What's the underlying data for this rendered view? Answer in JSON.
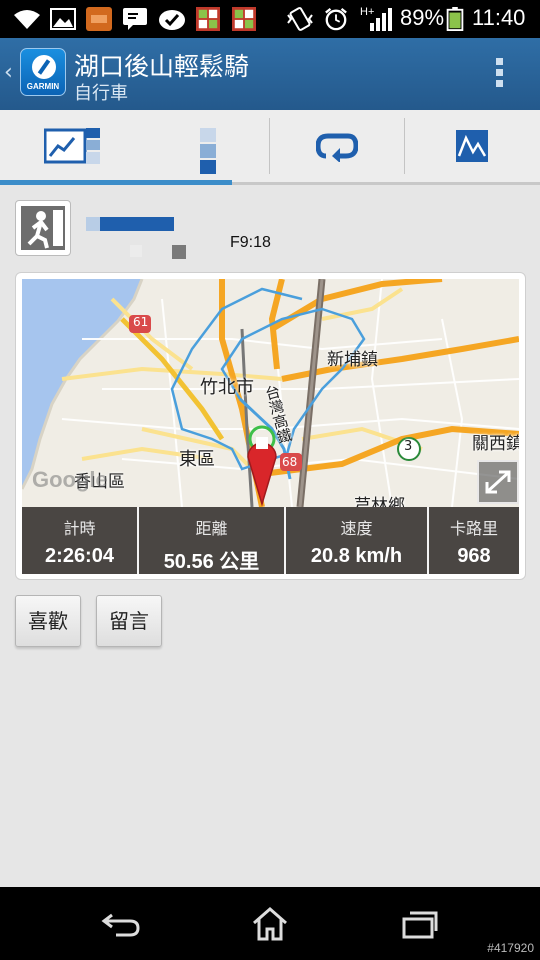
{
  "status_bar": {
    "icons": [
      "wifi-icon",
      "image-icon",
      "app-icon",
      "chat-icon",
      "check-icon",
      "grid-icon",
      "grid-icon",
      "vibrate-icon",
      "alarm-icon",
      "signal-icon",
      "battery-icon"
    ],
    "signal_label": "H+",
    "battery": "89%",
    "time": "11:40"
  },
  "action_bar": {
    "logo_text": "GARMIN",
    "title": "湖口後山輕鬆騎",
    "subtitle": "自行車"
  },
  "activity": {
    "time_text": "F9:18"
  },
  "map": {
    "labels": {
      "road_61": "61",
      "xinpu": "新埔鎮",
      "zhubei": "竹北市",
      "east_district": "東區",
      "xiangshan": "香山區",
      "guanxi": "關西鎮",
      "qionglin": "芎林鄉",
      "road_3": "3",
      "road_68": "68",
      "freeway": "台灣高鐵"
    },
    "google_text": "Google"
  },
  "stats": [
    {
      "label": "計時",
      "value": "2:26:04"
    },
    {
      "label": "距離",
      "value": "50.56 公里"
    },
    {
      "label": "速度",
      "value": "20.8 km/h"
    },
    {
      "label": "卡路里",
      "value": "968"
    }
  ],
  "buttons": {
    "like": "喜歡",
    "comment": "留言"
  },
  "watermark": "#417920",
  "colors": {
    "accent": "#3c8dc9",
    "action_bar": "#2a64997",
    "route": "#4a9fdc",
    "pin": "#d9262a"
  }
}
